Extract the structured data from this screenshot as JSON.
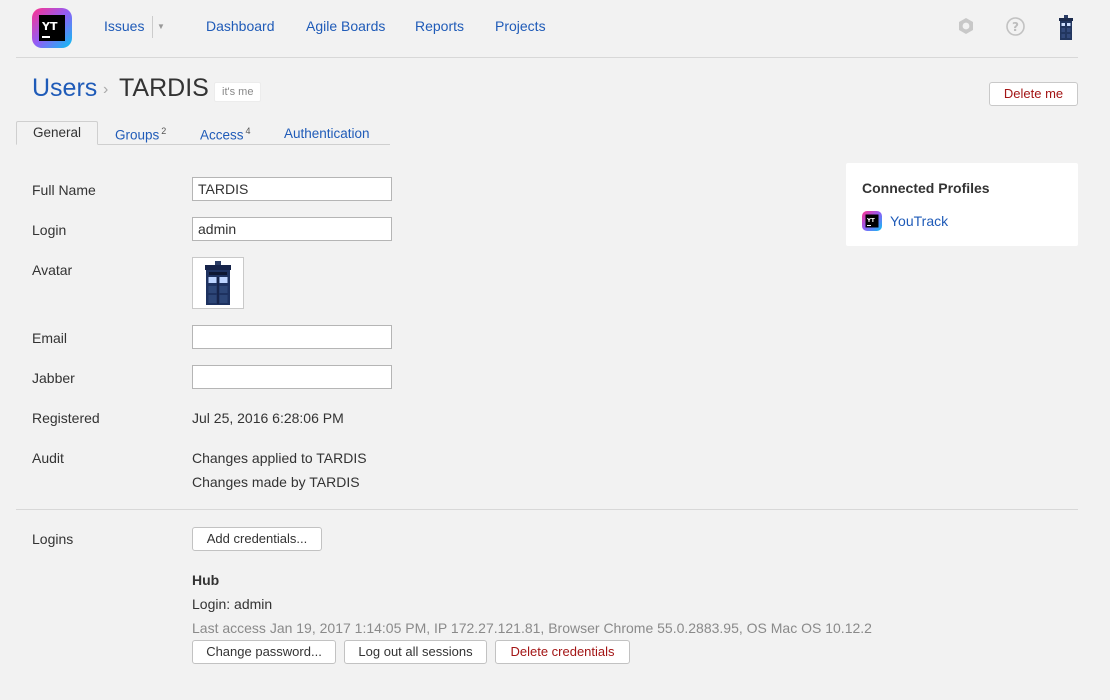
{
  "header": {
    "logo_text": "YT",
    "nav": {
      "issues": "Issues",
      "dashboard": "Dashboard",
      "agile_boards": "Agile Boards",
      "reports": "Reports",
      "projects": "Projects"
    },
    "help_glyph": "?",
    "icons": [
      "settings-icon",
      "help-icon",
      "user-avatar"
    ]
  },
  "breadcrumb": {
    "parent": "Users",
    "separator": "›",
    "current": "TARDIS",
    "badge": "it's me"
  },
  "actions": {
    "delete_me": "Delete me"
  },
  "tabs": [
    {
      "label": "General",
      "count": ""
    },
    {
      "label": "Groups",
      "count": "2"
    },
    {
      "label": "Access",
      "count": "4"
    },
    {
      "label": "Authentication",
      "count": ""
    }
  ],
  "form": {
    "full_name_label": "Full Name",
    "full_name_value": "TARDIS",
    "login_label": "Login",
    "login_value": "admin",
    "avatar_label": "Avatar",
    "email_label": "Email",
    "email_value": "",
    "jabber_label": "Jabber",
    "jabber_value": "",
    "registered_label": "Registered",
    "registered_value": "Jul 25, 2016 6:28:06 PM",
    "audit_label": "Audit",
    "audit_link_applied": "Changes applied to TARDIS",
    "audit_link_made": "Changes made by TARDIS"
  },
  "logins": {
    "label": "Logins",
    "add_credentials": "Add credentials...",
    "provider": "Hub",
    "login_line": "Login: admin",
    "last_access": "Last access Jan 19, 2017 1:14:05 PM, IP 172.27.121.81, Browser Chrome 55.0.2883.95, OS Mac OS 10.12.2",
    "change_password": "Change password...",
    "logout_all": "Log out all sessions",
    "delete_credentials": "Delete credentials"
  },
  "connected_profiles": {
    "title": "Connected Profiles",
    "items": [
      {
        "label": "YouTrack",
        "icon": "youtrack-logo"
      }
    ]
  },
  "colors": {
    "link": "#1f5bb8",
    "danger": "#a31515",
    "background": "#f2f2f2"
  }
}
